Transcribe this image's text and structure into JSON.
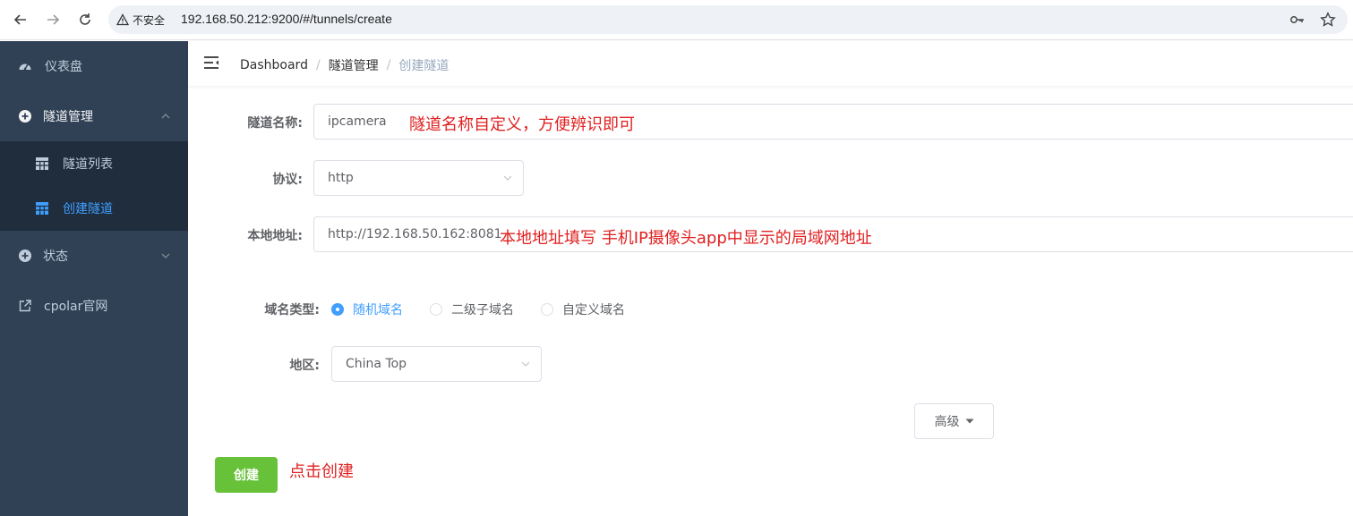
{
  "browser": {
    "security_label": "不安全",
    "url": "192.168.50.212:9200/#/tunnels/create"
  },
  "sidebar": {
    "items": [
      {
        "label": "仪表盘",
        "icon": "dashboard-icon"
      },
      {
        "label": "隧道管理",
        "icon": "plus-circle-icon"
      },
      {
        "label": "隧道列表",
        "icon": "table-icon"
      },
      {
        "label": "创建隧道",
        "icon": "table-icon"
      },
      {
        "label": "状态",
        "icon": "plus-circle-icon"
      },
      {
        "label": "cpolar官网",
        "icon": "external-link-icon"
      }
    ],
    "active_color": "#409eff",
    "bg_color": "#304156"
  },
  "breadcrumb": [
    "Dashboard",
    "隧道管理",
    "创建隧道"
  ],
  "form": {
    "tunnel_name_label": "隧道名称:",
    "tunnel_name_value": "ipcamera",
    "tunnel_name_note": "隧道名称自定义，方便辨识即可",
    "protocol_label": "协议:",
    "protocol_value": "http",
    "local_addr_label": "本地地址:",
    "local_addr_value": "http://192.168.50.162:8081",
    "local_addr_note": "本地地址填写 手机IP摄像头app中显示的局域网地址",
    "domain_type_label": "域名类型:",
    "domain_options": [
      "随机域名",
      "二级子域名",
      "自定义域名"
    ],
    "region_label": "地区:",
    "region_value": "China Top",
    "advanced_label": "高级",
    "create_label": "创建",
    "create_note": "点击创建"
  }
}
